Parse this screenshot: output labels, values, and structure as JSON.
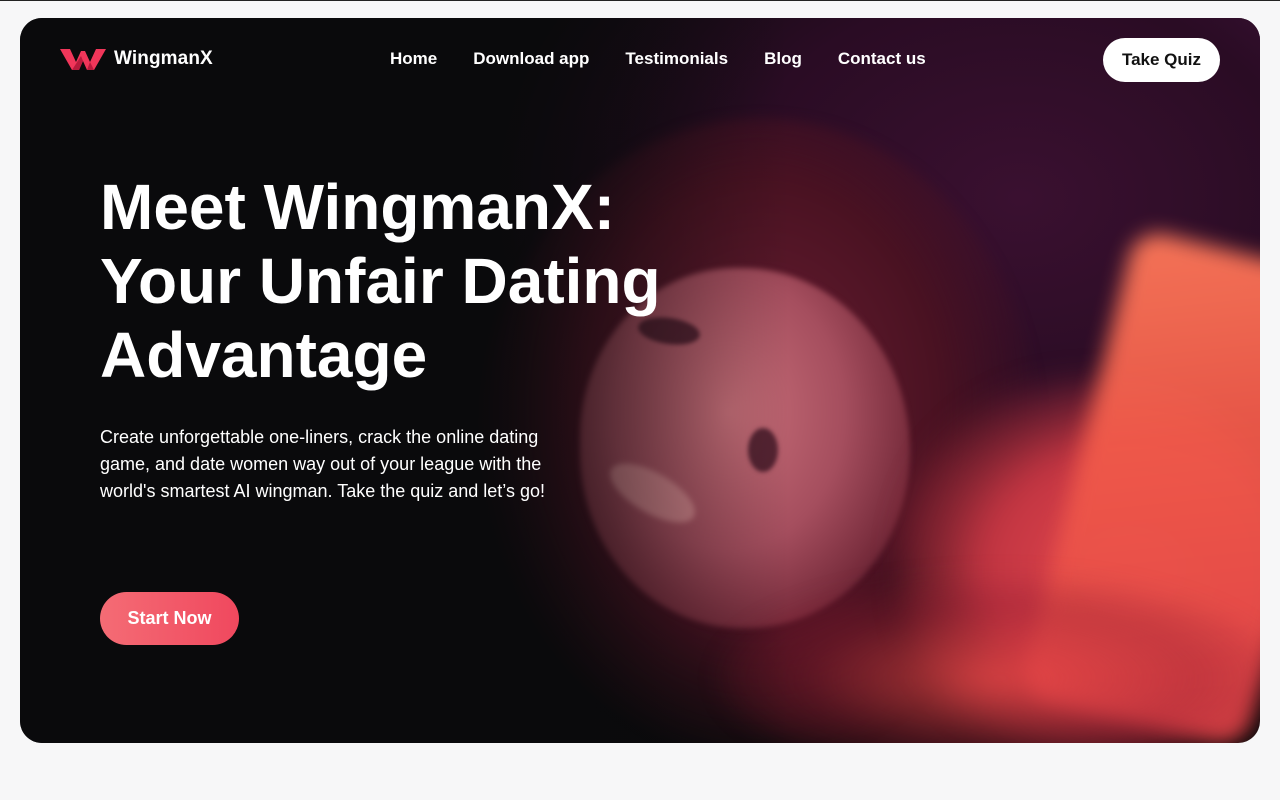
{
  "brand": {
    "name": "WingmanX",
    "logo_icon": "w-logo-icon",
    "accent_color": "#f0365a"
  },
  "nav": {
    "items": [
      {
        "label": "Home"
      },
      {
        "label": "Download app"
      },
      {
        "label": "Testimonials"
      },
      {
        "label": "Blog"
      },
      {
        "label": "Contact us"
      }
    ],
    "cta_label": "Take Quiz"
  },
  "hero": {
    "headline_lines": [
      "Meet WingmanX:",
      "Your Unfair Dating",
      "Advantage"
    ],
    "description": "Create unforgettable one-liners, crack the online dating game, and date women way out of your league with the world's smartest AI wingman. Take the quiz and let’s go!",
    "cta_label": "Start Now",
    "cta_colors": [
      "#f46c75",
      "#f0485e"
    ]
  }
}
